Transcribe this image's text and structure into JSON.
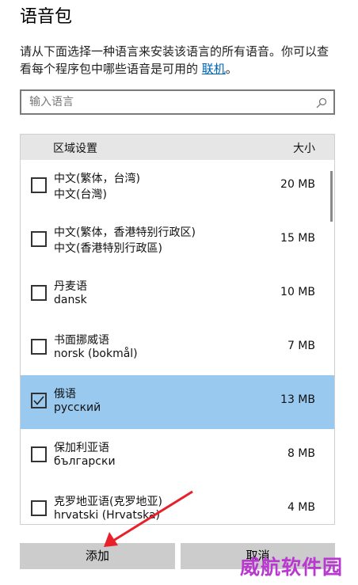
{
  "dialog": {
    "title": "语音包",
    "description": "请从下面选择一种语言来安装该语言的所有语音。你可以查看每个程序包中哪些语音是可用的 ",
    "link_text": "联机",
    "description_end": "。"
  },
  "search": {
    "placeholder": "输入语言",
    "icon": "search-icon"
  },
  "list": {
    "header_name": "区域设置",
    "header_size": "大小",
    "items": [
      {
        "name": "中文(繁体，台湾)",
        "native": "中文(台灣)",
        "size": "20 MB",
        "checked": false
      },
      {
        "name": "中文(繁体，香港特别行政区)",
        "native": "中文(香港特別行政區)",
        "size": "15 MB",
        "checked": false
      },
      {
        "name": "丹麦语",
        "native": "dansk",
        "size": "10 MB",
        "checked": false
      },
      {
        "name": "书面挪威语",
        "native": "norsk (bokmål)",
        "size": "7 MB",
        "checked": false
      },
      {
        "name": "俄语",
        "native": "русский",
        "size": "13 MB",
        "checked": true
      },
      {
        "name": "保加利亚语",
        "native": "български",
        "size": "8 MB",
        "checked": false
      },
      {
        "name": "克罗地亚语(克罗地亚)",
        "native": "hrvatski (Hrvatska)",
        "size": "4 MB",
        "checked": false
      }
    ]
  },
  "buttons": {
    "add_label": "添加",
    "cancel_label": "取消"
  },
  "watermark": "威航软件园",
  "colors": {
    "accent_link": "#0063b1",
    "selected_row": "#99c9ef",
    "arrow": "#e8202a",
    "watermark": "#b838d0"
  }
}
